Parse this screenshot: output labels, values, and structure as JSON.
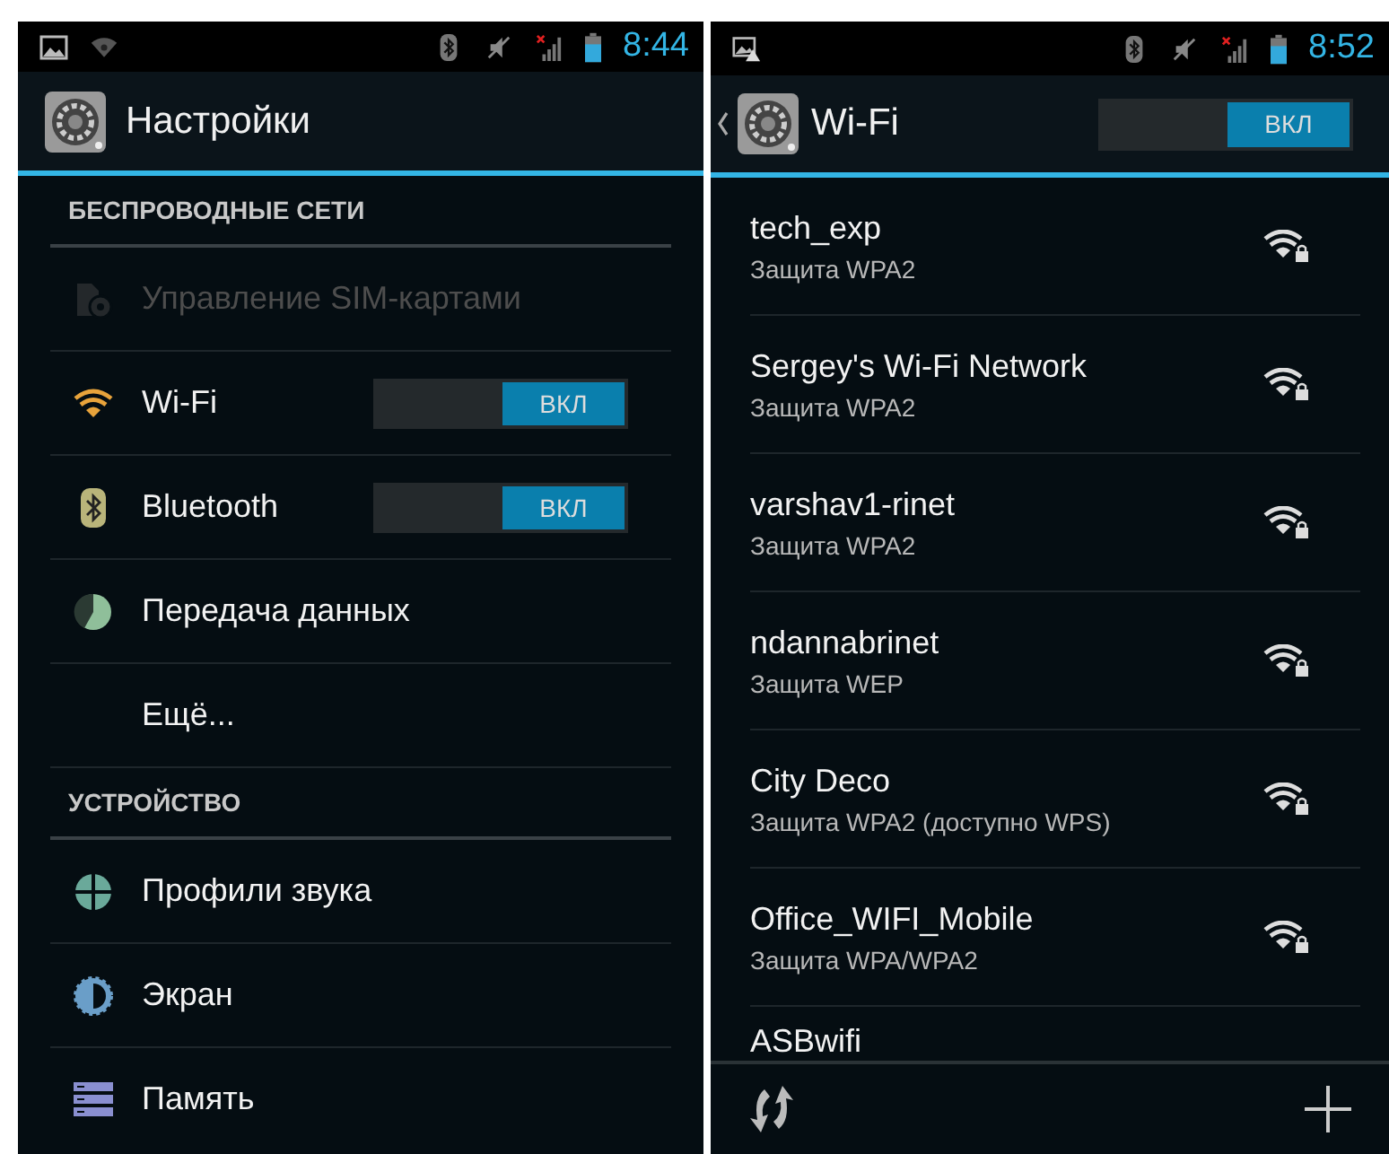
{
  "settings_screen": {
    "status_bar": {
      "time": "8:44"
    },
    "title": "Настройки",
    "sections": [
      {
        "header": "БЕСПРОВОДНЫЕ СЕТИ",
        "items": [
          {
            "label": "Управление SIM-картами",
            "disabled": true
          },
          {
            "label": "Wi-Fi",
            "disabled": false,
            "toggle": {
              "label": "ВКЛ",
              "on": true
            }
          },
          {
            "label": "Bluetooth",
            "disabled": false,
            "toggle": {
              "label": "ВКЛ",
              "on": true
            }
          },
          {
            "label": "Передача данных",
            "disabled": false
          },
          {
            "label": "Ещё...",
            "disabled": false
          }
        ]
      },
      {
        "header": "УСТРОЙСТВО",
        "items": [
          {
            "label": "Профили звука",
            "disabled": false
          },
          {
            "label": "Экран",
            "disabled": false
          },
          {
            "label": "Память",
            "disabled": false
          }
        ]
      }
    ]
  },
  "wifi_screen": {
    "status_bar": {
      "time": "8:52"
    },
    "title": "Wi-Fi",
    "toggle": {
      "label": "ВКЛ",
      "on": true
    },
    "networks": [
      {
        "name": "tech_exp",
        "security": "Защита WPA2"
      },
      {
        "name": "Sergey's Wi-Fi Network",
        "security": "Защита WPA2"
      },
      {
        "name": "varshav1-rinet",
        "security": "Защита WPA2"
      },
      {
        "name": "ndannabrinet",
        "security": "Защита WEP"
      },
      {
        "name": "City Deco",
        "security": "Защита WPA2 (доступно WPS)"
      },
      {
        "name": "Office_WIFI_Mobile",
        "security": "Защита WPA/WPA2"
      },
      {
        "name": "ASBwifi"
      }
    ]
  }
}
